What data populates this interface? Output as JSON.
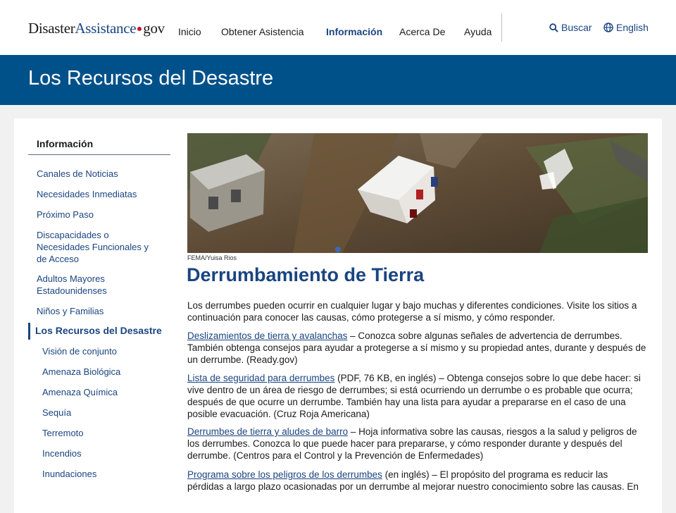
{
  "header": {
    "logo": {
      "part1": "Disaster",
      "part2": "Assistance",
      "part3": "gov"
    },
    "nav": [
      "Inicio",
      "Obtener Asistencia",
      "Información",
      "Acerca De",
      "Ayuda"
    ],
    "search_label": "Buscar",
    "language_label": "English"
  },
  "banner": {
    "title": "Los Recursos del Desastre"
  },
  "sidebar": {
    "title": "Información",
    "items": [
      "Canales de Noticias",
      "Necesidades Inmediatas",
      "Próximo Paso",
      "Discapacidades o Necesidades Funcionales y de Acceso",
      "Adultos Mayores Estadounidenses",
      "Niños y Familias",
      "Los Recursos del Desastre",
      "Visión de conjunto",
      "Amenaza Biológica",
      "Amenaza Química",
      "Sequía",
      "Terremoto",
      "Incendios",
      "Inundaciones"
    ]
  },
  "main": {
    "image_credit": "FEMA/Yuisa Rios",
    "title": "Derrumbamiento de Tierra",
    "intro": "Los derrumbes pueden ocurrir en cualquier lugar y bajo muchas y diferentes condiciones. Visite los sitios a continuación para conocer las causas, cómo protegerse a sí mismo, y cómo responder.",
    "resources": [
      {
        "link": "Deslizamientos de tierra y avalanchas",
        "text": " – Conozca sobre algunas señales de advertencia de derrumbes. También obtenga consejos para ayudar a protegerse a sí mismo y su propiedad antes, durante y después de un derrumbe. (Ready.gov)"
      },
      {
        "link": "Lista de seguridad para derrumbes",
        "text": " (PDF, 76 KB, en inglés) – Obtenga consejos sobre lo que debe hacer: si vive dentro de un área de riesgo de derrumbes; si está ocurriendo un derrumbe o es probable que ocurra; después de que ocurre un derrumbe. También hay una lista para ayudar a prepararse en el caso de una posible evacuación. (Cruz Roja Americana)"
      },
      {
        "link": "Derrumbes de tierra y aludes de barro",
        "text": " – Hoja informativa sobre las causas, riesgos a la salud y peligros de los derrumbes. Conozca lo que puede hacer para prepararse, y cómo responder durante y después del derrumbe. (Centros para el Control y la Prevención de Enfermedades)"
      },
      {
        "link": "Programa sobre los peligros de los derrumbes",
        "text": " (en inglés) – El propósito del programa es reducir las pérdidas a largo plazo ocasionadas por un derrumbe al mejorar nuestro conocimiento sobre las causas. En"
      }
    ]
  },
  "colors": {
    "brand_blue": "#00518a",
    "link_blue": "#1a4480",
    "accent_red": "#c41230"
  }
}
